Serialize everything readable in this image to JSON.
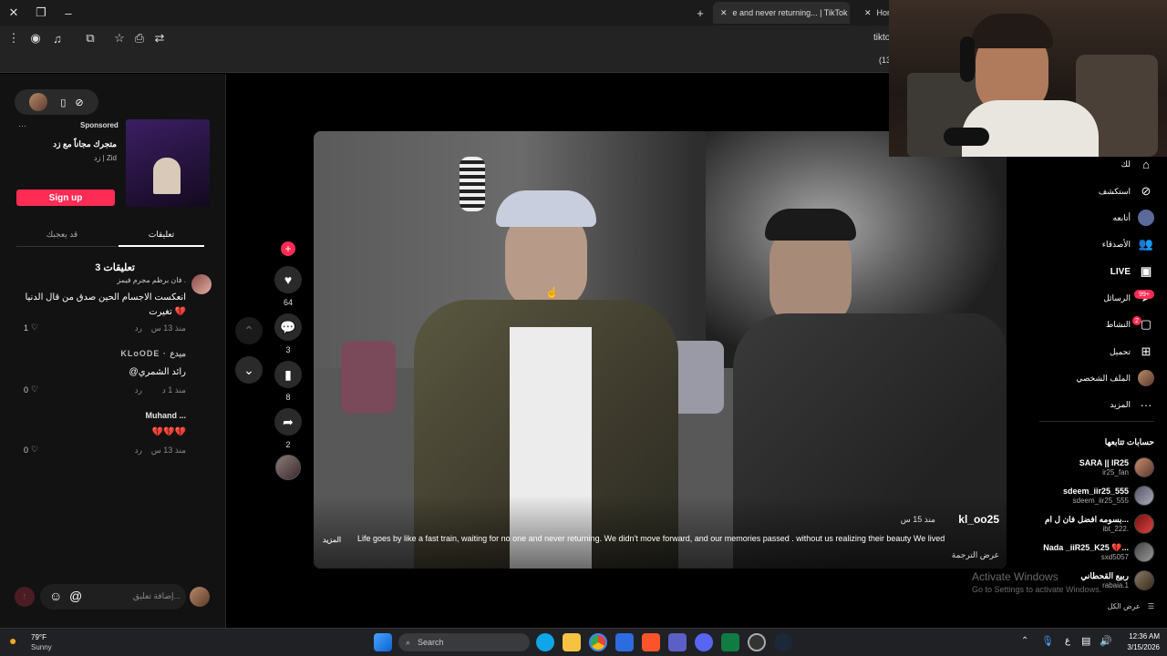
{
  "browser": {
    "tabs": [
      {
        "title": "e and never returning... | TikTok",
        "active": true
      },
      {
        "title": "Hon",
        "active": false
      }
    ],
    "url_fragment": "tikto",
    "bookmark_fragment": "(13"
  },
  "sidebar_left": {
    "ad": {
      "sponsored_label": "Sponsored",
      "headline": "متجرك مجاناً مع زد",
      "brand": "زد | Zid",
      "cta": "Sign up"
    },
    "tabs": [
      "تعليقات",
      "قد يعجبك"
    ],
    "comments_header": "3 تعليقات",
    "comments": [
      {
        "name": "فان برظم مجرم فيمز .",
        "text": "انعكست الاجسام الحين صدق من قال الدنيا تغيرت 💔",
        "time": "منذ 13 س",
        "reply": "رد",
        "likes": "1"
      },
      {
        "name": "KLoODE · مبدع",
        "text": "@رائد الشمري",
        "time": "منذ 1 د",
        "reply": "رد",
        "likes": "0"
      },
      {
        "name": "Muhand ...",
        "text": "💔💔💔",
        "time": "منذ 13 س",
        "reply": "رد",
        "likes": "0"
      }
    ],
    "comment_input_placeholder": "إضافة تعليق..."
  },
  "video": {
    "author": "kl_oo25",
    "time": "منذ 15 س",
    "caption": "Life goes by like a fast train, waiting for no one and never returning. We didn't move forward, and our memories passed . without us realizing their beauty We lived",
    "more": "المزيد",
    "translate": "عرض الترجمة"
  },
  "actions": {
    "likes": "64",
    "comments": "3",
    "saves": "8",
    "shares": "2"
  },
  "nav": {
    "items": [
      {
        "label": "لك",
        "icon": "home-icon"
      },
      {
        "label": "استكشف",
        "icon": "compass-icon"
      },
      {
        "label": "أتابعه",
        "icon": "avatar"
      },
      {
        "label": "الأصدقاء",
        "icon": "friends-icon"
      },
      {
        "label": "LIVE",
        "icon": "live-icon"
      },
      {
        "label": "الرسائل",
        "icon": "send-icon",
        "badge": "99+"
      },
      {
        "label": "النشاط",
        "icon": "chat-icon",
        "badge": "2"
      },
      {
        "label": "تحميل",
        "icon": "upload-icon"
      },
      {
        "label": "الملف الشخصي",
        "icon": "profile-avatar"
      },
      {
        "label": "المزيد",
        "icon": "more-icon"
      }
    ],
    "following_header": "حسابات تتابعها",
    "following": [
      {
        "name": "SARA || IR25",
        "handle": "ir25_fan"
      },
      {
        "name": "sdeem_iir25_555",
        "handle": "sdeem_iir25_555"
      },
      {
        "name": "بسومه افضل فان ل ام...",
        "handle": "ibt_222."
      },
      {
        "name": "Nada _iiR25_K25 💔...",
        "handle": "sxd5057"
      },
      {
        "name": "ربيع القحطاني",
        "handle": "rabaia.1"
      }
    ],
    "see_all": "عرض الكل"
  },
  "watermark": {
    "title": "Activate Windows",
    "subtitle": "Go to Settings to activate Windows."
  },
  "taskbar": {
    "weather_temp": "79°F",
    "weather_desc": "Sunny",
    "search_placeholder": "Search",
    "time": "12:36 AM",
    "date": "3/15/2026",
    "lang": "ع"
  }
}
